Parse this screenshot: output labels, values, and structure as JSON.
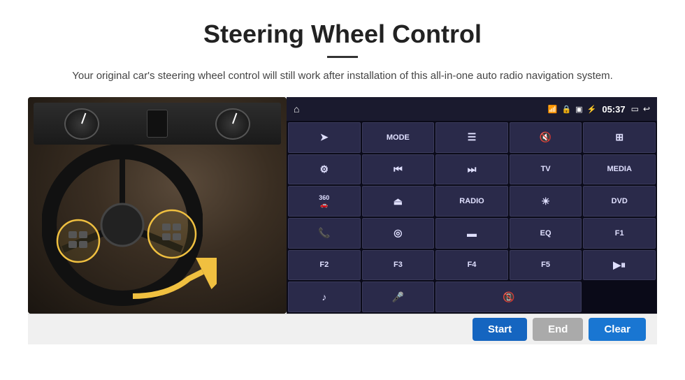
{
  "header": {
    "title": "Steering Wheel Control",
    "subtitle": "Your original car's steering wheel control will still work after installation of this all-in-one auto radio navigation system."
  },
  "statusbar": {
    "time": "05:37"
  },
  "panel_buttons": [
    {
      "id": "nav",
      "icon": "➤",
      "label": "",
      "row": 1,
      "col": 1
    },
    {
      "id": "mode",
      "icon": "",
      "label": "MODE",
      "row": 1,
      "col": 2
    },
    {
      "id": "list",
      "icon": "☰",
      "label": "",
      "row": 1,
      "col": 3
    },
    {
      "id": "mute",
      "icon": "🔇",
      "label": "",
      "row": 1,
      "col": 4
    },
    {
      "id": "apps",
      "icon": "⊞",
      "label": "",
      "row": 1,
      "col": 5
    },
    {
      "id": "settings",
      "icon": "⚙",
      "label": "",
      "row": 2,
      "col": 1
    },
    {
      "id": "prev",
      "icon": "⏮",
      "label": "",
      "row": 2,
      "col": 2
    },
    {
      "id": "next",
      "icon": "⏭",
      "label": "",
      "row": 2,
      "col": 3
    },
    {
      "id": "tv",
      "icon": "",
      "label": "TV",
      "row": 2,
      "col": 4
    },
    {
      "id": "media",
      "icon": "",
      "label": "MEDIA",
      "row": 2,
      "col": 5
    },
    {
      "id": "360",
      "icon": "360",
      "label": "",
      "row": 3,
      "col": 1
    },
    {
      "id": "eject",
      "icon": "⏏",
      "label": "",
      "row": 3,
      "col": 2
    },
    {
      "id": "radio",
      "icon": "",
      "label": "RADIO",
      "row": 3,
      "col": 3
    },
    {
      "id": "brightness",
      "icon": "☀",
      "label": "",
      "row": 3,
      "col": 4
    },
    {
      "id": "dvd",
      "icon": "",
      "label": "DVD",
      "row": 3,
      "col": 5
    },
    {
      "id": "phone",
      "icon": "📞",
      "label": "",
      "row": 4,
      "col": 1
    },
    {
      "id": "swipe",
      "icon": "◎",
      "label": "",
      "row": 4,
      "col": 2
    },
    {
      "id": "dash",
      "icon": "▬",
      "label": "",
      "row": 4,
      "col": 3
    },
    {
      "id": "eq",
      "icon": "",
      "label": "EQ",
      "row": 4,
      "col": 4
    },
    {
      "id": "f1",
      "icon": "",
      "label": "F1",
      "row": 4,
      "col": 5
    },
    {
      "id": "f2",
      "icon": "",
      "label": "F2",
      "row": 5,
      "col": 1
    },
    {
      "id": "f3",
      "icon": "",
      "label": "F3",
      "row": 5,
      "col": 2
    },
    {
      "id": "f4",
      "icon": "",
      "label": "F4",
      "row": 5,
      "col": 3
    },
    {
      "id": "f5",
      "icon": "",
      "label": "F5",
      "row": 5,
      "col": 4
    },
    {
      "id": "playpause",
      "icon": "▶⏸",
      "label": "",
      "row": 5,
      "col": 5
    },
    {
      "id": "music",
      "icon": "♪",
      "label": "",
      "row": 6,
      "col": 1
    },
    {
      "id": "mic",
      "icon": "🎤",
      "label": "",
      "row": 6,
      "col": 2
    },
    {
      "id": "callend",
      "icon": "📵",
      "label": "",
      "row": 6,
      "col": 3
    }
  ],
  "bottom_bar": {
    "start_label": "Start",
    "end_label": "End",
    "clear_label": "Clear"
  }
}
